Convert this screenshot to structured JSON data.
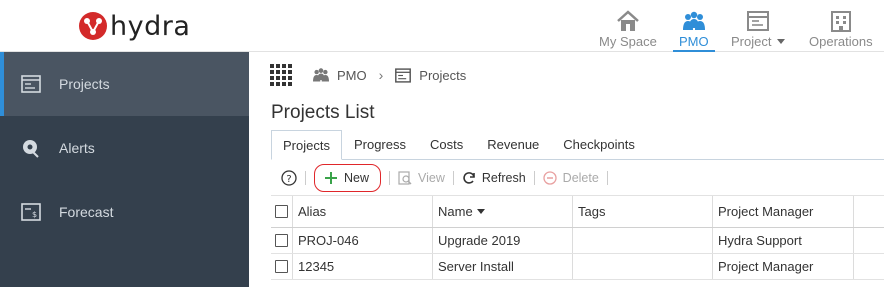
{
  "app": {
    "brand": "hydra",
    "accent": "#2f8ed8",
    "logo_color": "#d32a2a"
  },
  "topnav": [
    {
      "label": "My Space",
      "icon": "home-icon",
      "active": false
    },
    {
      "label": "PMO",
      "icon": "people-icon",
      "active": true
    },
    {
      "label": "Project",
      "icon": "project-icon",
      "active": false,
      "has_dropdown": true
    },
    {
      "label": "Operations",
      "icon": "building-icon",
      "active": false
    }
  ],
  "sidebar": {
    "items": [
      {
        "label": "Projects",
        "icon": "projects-icon",
        "active": true
      },
      {
        "label": "Alerts",
        "icon": "alerts-icon",
        "active": false
      },
      {
        "label": "Forecast",
        "icon": "forecast-icon",
        "active": false
      }
    ]
  },
  "breadcrumb": {
    "root": "PMO",
    "current": "Projects"
  },
  "page": {
    "title": "Projects List"
  },
  "tabs": [
    {
      "label": "Projects",
      "active": true
    },
    {
      "label": "Progress"
    },
    {
      "label": "Costs"
    },
    {
      "label": "Revenue"
    },
    {
      "label": "Checkpoints"
    }
  ],
  "toolbar": {
    "help": "?",
    "new_label": "New",
    "view_label": "View",
    "refresh_label": "Refresh",
    "delete_label": "Delete"
  },
  "grid": {
    "columns": [
      "Alias",
      "Name",
      "Tags",
      "Project Manager"
    ],
    "sorted_column": "Name",
    "rows": [
      {
        "alias": "PROJ-046",
        "name": "Upgrade 2019",
        "tags": "",
        "pm": "Hydra Support"
      },
      {
        "alias": "12345",
        "name": "Server Install",
        "tags": "",
        "pm": "Project Manager"
      }
    ]
  }
}
